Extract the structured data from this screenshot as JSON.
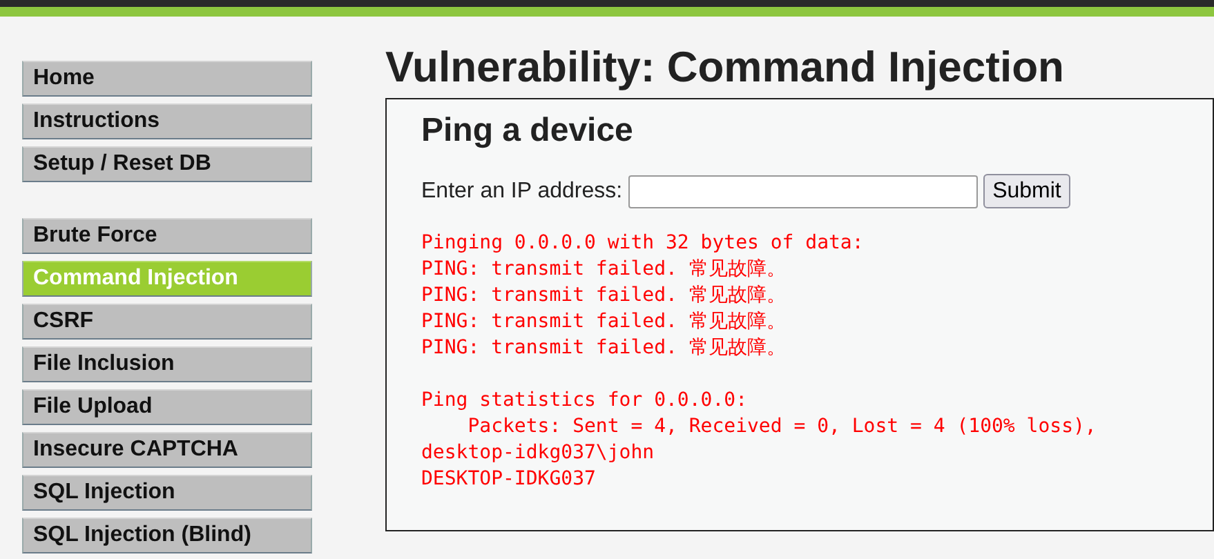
{
  "menu_groups": [
    [
      {
        "label": "Home",
        "selected": false
      },
      {
        "label": "Instructions",
        "selected": false
      },
      {
        "label": "Setup / Reset DB",
        "selected": false
      }
    ],
    [
      {
        "label": "Brute Force",
        "selected": false
      },
      {
        "label": "Command Injection",
        "selected": true
      },
      {
        "label": "CSRF",
        "selected": false
      },
      {
        "label": "File Inclusion",
        "selected": false
      },
      {
        "label": "File Upload",
        "selected": false
      },
      {
        "label": "Insecure CAPTCHA",
        "selected": false
      },
      {
        "label": "SQL Injection",
        "selected": false
      },
      {
        "label": "SQL Injection (Blind)",
        "selected": false
      }
    ]
  ],
  "page_title": "Vulnerability: Command Injection",
  "panel": {
    "heading": "Ping a device",
    "field_label": "Enter an IP address:",
    "submit": "Submit",
    "output": [
      [
        "Pinging 0.0.0.0 with 32 bytes of data:",
        "PING: transmit failed. 常见故障。",
        "PING: transmit failed. 常见故障。",
        "PING: transmit failed. 常见故障。",
        "PING: transmit failed. 常见故障。"
      ],
      [
        "Ping statistics for 0.0.0.0:",
        "    Packets: Sent = 4, Received = 0, Lost = 4 (100% loss),",
        "desktop-idkg037\\john",
        "DESKTOP-IDKG037"
      ]
    ]
  }
}
